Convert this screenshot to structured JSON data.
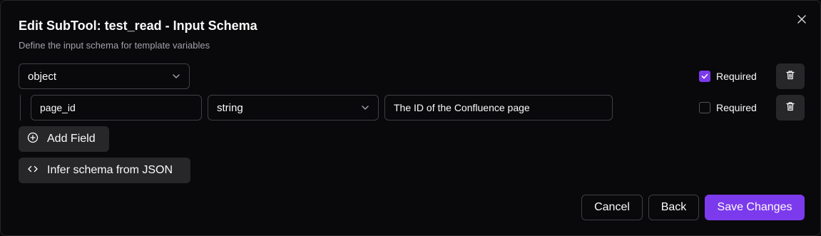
{
  "dialog": {
    "title": "Edit SubTool: test_read - Input Schema",
    "subtitle": "Define the input schema for template variables",
    "close_icon": "close-icon"
  },
  "root": {
    "type": "object",
    "required_label": "Required",
    "required": true
  },
  "fields": [
    {
      "name": "page_id",
      "type": "string",
      "description": "The ID of the Confluence page",
      "required_label": "Required",
      "required": false
    }
  ],
  "actions": {
    "add_field": "Add Field",
    "infer_schema": "Infer schema from JSON"
  },
  "footer": {
    "cancel": "Cancel",
    "back": "Back",
    "save": "Save Changes"
  },
  "colors": {
    "accent": "#7c3aed",
    "background": "#09090b",
    "muted_text": "#a1a1aa",
    "border": "#3f3f46",
    "secondary_bg": "#27272a"
  }
}
